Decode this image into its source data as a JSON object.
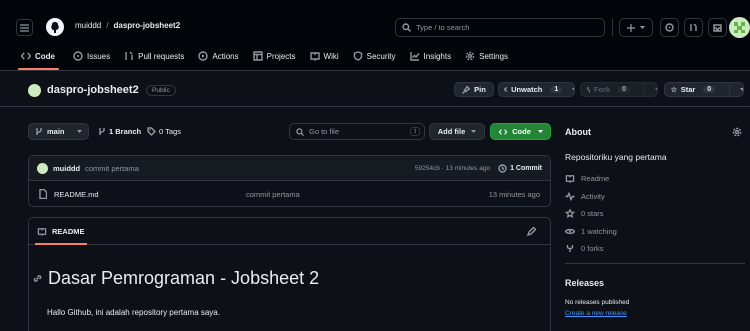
{
  "header": {
    "owner": "muiddd",
    "separator": "/",
    "repo": "daspro-jobsheet2",
    "search_placeholder": "Type / to search"
  },
  "nav": {
    "tabs": [
      "Code",
      "Issues",
      "Pull requests",
      "Actions",
      "Projects",
      "Wiki",
      "Security",
      "Insights",
      "Settings"
    ]
  },
  "repo": {
    "name": "daspro-jobsheet2",
    "visibility": "Public",
    "pin_label": "Pin",
    "unwatch_label": "Unwatch",
    "unwatch_count": "1",
    "fork_label": "Fork",
    "fork_count": "0",
    "star_label": "Star",
    "star_count": "0"
  },
  "toolbar": {
    "branch": "main",
    "branches": "1 Branch",
    "tags": "0 Tags",
    "goto_placeholder": "Go to file",
    "goto_kbd": "t",
    "add_file": "Add file",
    "code": "Code"
  },
  "commit": {
    "author": "muiddd",
    "message": "commit pertama",
    "meta": "59254cb · 13 minutes ago",
    "count": "1 Commit"
  },
  "files": [
    {
      "name": "README.md",
      "message": "commit pertama",
      "time": "13 minutes ago"
    }
  ],
  "readme": {
    "tab": "README",
    "title": "Dasar Pemrograman - Jobsheet 2",
    "body": "Hallo Github, ini adalah repository pertama saya."
  },
  "about": {
    "title": "About",
    "description": "Repositoriku yang pertama",
    "items": [
      "Readme",
      "Activity",
      "0 stars",
      "1 watching",
      "0 forks"
    ]
  },
  "releases": {
    "title": "Releases",
    "none": "No releases published",
    "create": "Create a new release"
  },
  "colors": {
    "accent_green": "#238636",
    "link_blue": "#4493f8",
    "tab_underline": "#f78166"
  }
}
